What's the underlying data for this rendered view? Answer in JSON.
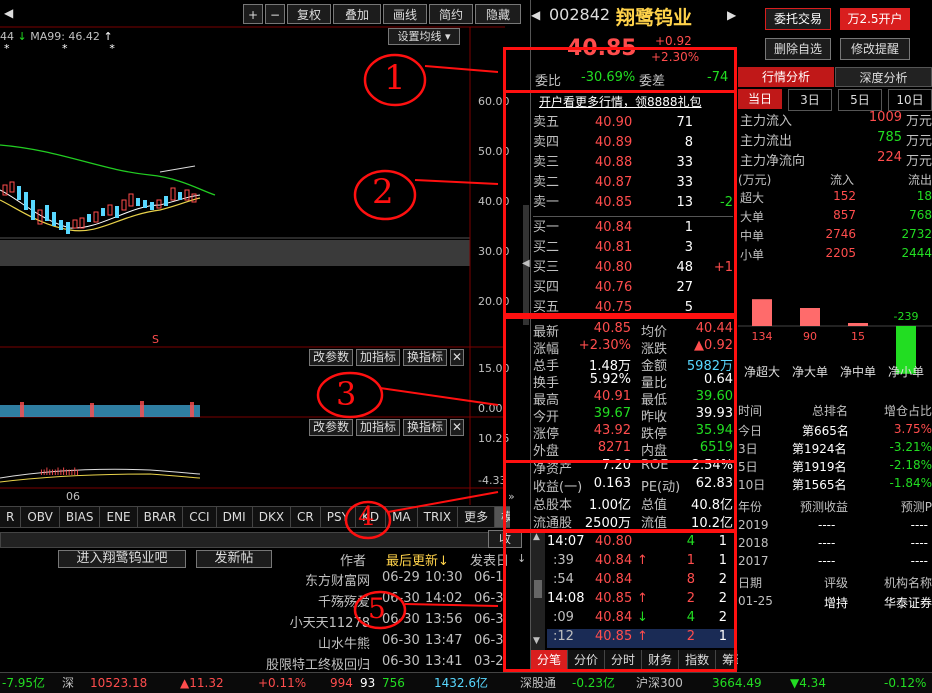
{
  "colors": {
    "up": "#ff4d4d",
    "down": "#22dd22",
    "bg": "#000000",
    "annotation": "#ff1010"
  },
  "toolbar": {
    "buttons": [
      "+",
      "−",
      "复权",
      "叠加",
      "画线",
      "简约",
      "隐藏"
    ]
  },
  "ma_legend": {
    "ma44": "44",
    "ma99_label": "MA99: 46.42"
  },
  "settings_btn": "设置均线",
  "price_axis": [
    "60.00",
    "50.00",
    "40.00",
    "30.00",
    "20.00"
  ],
  "price_axis_mark": "S",
  "ind1": {
    "buttons": [
      "改参数",
      "加指标",
      "换指标"
    ],
    "axis": [
      "15.00",
      "0.00"
    ]
  },
  "ind2": {
    "buttons": [
      "改参数",
      "加指标",
      "换指标"
    ],
    "axis": [
      "10.25",
      "-4.33"
    ]
  },
  "date_label": "06",
  "indicator_tabs": [
    "R",
    "OBV",
    "BIAS",
    "ENE",
    "BRAR",
    "CCI",
    "DMI",
    "DKX",
    "CR",
    "PSY",
    "KD",
    "MA",
    "TRIX",
    "更多",
    "模"
  ],
  "forum": {
    "title_btn": "进入翔鹭钨业吧",
    "post_btn": "发新帖",
    "col_author": "作者",
    "col_updated": "最后更新↓",
    "col_posted": "发表日",
    "collapse": "收",
    "rows": [
      {
        "author": "东方财富网",
        "date": "06-29",
        "time": "10:30",
        "post": "06-1"
      },
      {
        "author": "千殇殇爱",
        "date": "06-30",
        "time": "14:02",
        "post": "06-3"
      },
      {
        "author": "小天天11278",
        "date": "06-30",
        "time": "13:56",
        "post": "06-3"
      },
      {
        "author": "山水牛熊",
        "date": "06-30",
        "time": "13:47",
        "post": "06-3"
      },
      {
        "author": "股限特工终极回归",
        "date": "06-30",
        "time": "13:41",
        "post": "03-2"
      }
    ]
  },
  "stock": {
    "code": "002842",
    "name": "翔鹭钨业",
    "price": "40.85",
    "change": "+0.92",
    "change_pct": "+2.30%"
  },
  "actions": {
    "trust": "委托交易",
    "open": "万2.5开户",
    "remove": "删除自选",
    "edit": "修改提醒"
  },
  "weibi": {
    "label": "委比",
    "value": "-30.69%",
    "diff_label": "委差",
    "diff": "-74"
  },
  "promo": "开户看更多行情，领8888礼包",
  "sells": [
    {
      "label": "卖五",
      "price": "40.90",
      "vol": "71",
      "chg": ""
    },
    {
      "label": "卖四",
      "price": "40.89",
      "vol": "8",
      "chg": ""
    },
    {
      "label": "卖三",
      "price": "40.88",
      "vol": "33",
      "chg": ""
    },
    {
      "label": "卖二",
      "price": "40.87",
      "vol": "33",
      "chg": ""
    },
    {
      "label": "卖一",
      "price": "40.85",
      "vol": "13",
      "chg": "-2"
    }
  ],
  "buys": [
    {
      "label": "买一",
      "price": "40.84",
      "vol": "1",
      "chg": ""
    },
    {
      "label": "买二",
      "price": "40.81",
      "vol": "3",
      "chg": ""
    },
    {
      "label": "买三",
      "price": "40.80",
      "vol": "48",
      "chg": "+1"
    },
    {
      "label": "买四",
      "price": "40.76",
      "vol": "27",
      "chg": ""
    },
    {
      "label": "买五",
      "price": "40.75",
      "vol": "5",
      "chg": ""
    }
  ],
  "stats": [
    {
      "l1": "最新",
      "v1": "40.85",
      "l2": "均价",
      "v2": "40.44"
    },
    {
      "l1": "涨幅",
      "v1": "+2.30%",
      "l2": "涨跌",
      "v2": "▲0.92"
    },
    {
      "l1": "总手",
      "v1": "1.48万",
      "l2": "金额",
      "v2": "5982万"
    },
    {
      "l1": "换手",
      "v1": "5.92%",
      "l2": "量比",
      "v2": "0.64"
    },
    {
      "l1": "最高",
      "v1": "40.91",
      "l2": "最低",
      "v2": "39.60"
    },
    {
      "l1": "今开",
      "v1": "39.67",
      "l2": "昨收",
      "v2": "39.93"
    },
    {
      "l1": "涨停",
      "v1": "43.92",
      "l2": "跌停",
      "v2": "35.94"
    },
    {
      "l1": "外盘",
      "v1": "8271",
      "l2": "内盘",
      "v2": "6519"
    }
  ],
  "fundamentals": [
    {
      "l1": "净资产",
      "v1": "7.20",
      "l2": "ROE",
      "v2": "2.54%"
    },
    {
      "l1": "收益(一)",
      "v1": "0.163",
      "l2": "PE(动)",
      "v2": "62.83"
    },
    {
      "l1": "总股本",
      "v1": "1.00亿",
      "l2": "总值",
      "v2": "40.8亿"
    },
    {
      "l1": "流通股",
      "v1": "2500万",
      "l2": "流值",
      "v2": "10.2亿"
    }
  ],
  "ticks": [
    {
      "time": "14:07",
      "price": "40.80",
      "arrow": "",
      "vol": "4",
      "n": "1"
    },
    {
      "time": ":39",
      "price": "40.84",
      "arrow": "↑",
      "vol": "1",
      "n": "1"
    },
    {
      "time": ":54",
      "price": "40.84",
      "arrow": "",
      "vol": "8",
      "n": "2"
    },
    {
      "time": "14:08",
      "price": "40.85",
      "arrow": "↑",
      "vol": "2",
      "n": "2"
    },
    {
      "time": ":09",
      "price": "40.84",
      "arrow": "↓",
      "vol": "4",
      "n": "2"
    },
    {
      "time": ":12",
      "price": "40.85",
      "arrow": "↑",
      "vol": "2",
      "n": "1"
    }
  ],
  "tick_tabs": [
    "分笔",
    "分价",
    "分时",
    "财务",
    "指数",
    "筹码"
  ],
  "annotations": [
    "1",
    "2",
    "3",
    "4",
    "5"
  ],
  "right": {
    "tabs": [
      "行情分析",
      "深度分析"
    ],
    "periods": [
      "当日",
      "3日",
      "5日",
      "10日"
    ],
    "flows": [
      {
        "label": "主力流入",
        "value": "1009",
        "unit": "万元"
      },
      {
        "label": "主力流出",
        "value": "785",
        "unit": "万元"
      },
      {
        "label": "主力净流向",
        "value": "224",
        "unit": "万元"
      }
    ],
    "table_head": {
      "unit": "(万元)",
      "in": "流入",
      "out": "流出"
    },
    "table": [
      {
        "label": "超大",
        "in": "152",
        "out": "18"
      },
      {
        "label": "大单",
        "in": "857",
        "out": "768"
      },
      {
        "label": "中单",
        "in": "2746",
        "out": "2732"
      },
      {
        "label": "小单",
        "in": "2205",
        "out": "2444"
      }
    ],
    "bars": {
      "values": [
        134,
        90,
        15,
        -239
      ],
      "labels": [
        "净超大",
        "净大单",
        "净中单",
        "净小单"
      ]
    },
    "rank_head": {
      "time": "时间",
      "rank": "总排名",
      "pct": "增仓占比"
    },
    "ranks": [
      {
        "time": "今日",
        "rank": "第665名",
        "pct": "3.75%"
      },
      {
        "time": "3日",
        "rank": "第1924名",
        "pct": "-3.21%"
      },
      {
        "time": "5日",
        "rank": "第1919名",
        "pct": "-2.18%"
      },
      {
        "time": "10日",
        "rank": "第1565名",
        "pct": "-1.84%"
      }
    ],
    "forecast_head": {
      "year": "年份",
      "eps": "预测收益",
      "pe": "预测P"
    },
    "forecast": [
      {
        "year": "2019",
        "eps": "----",
        "pe": "----"
      },
      {
        "year": "2018",
        "eps": "----",
        "pe": "----"
      },
      {
        "year": "2017",
        "eps": "----",
        "pe": "----"
      }
    ],
    "rating_head": {
      "date": "日期",
      "rating": "评级",
      "org": "机构名称"
    },
    "rating": {
      "date": "01-25",
      "rating": "增持",
      "org": "华泰证券"
    }
  },
  "status_bar": {
    "left": "-7.95亿",
    "sz_label": "深",
    "sz_index": "10523.18",
    "sz_chg": "▲11.32",
    "sz_pct": "+0.11%",
    "sz_up": "994",
    "sz_flat": "93",
    "sz_down": "756",
    "sz_amt": "1432.6亿",
    "sgt_label": "深股通",
    "sgt_val": "-0.23亿",
    "hs_label": "沪深300",
    "hs_index": "3664.49",
    "hs_chg": "▼4.34",
    "hs_pct": "-0.12%"
  }
}
